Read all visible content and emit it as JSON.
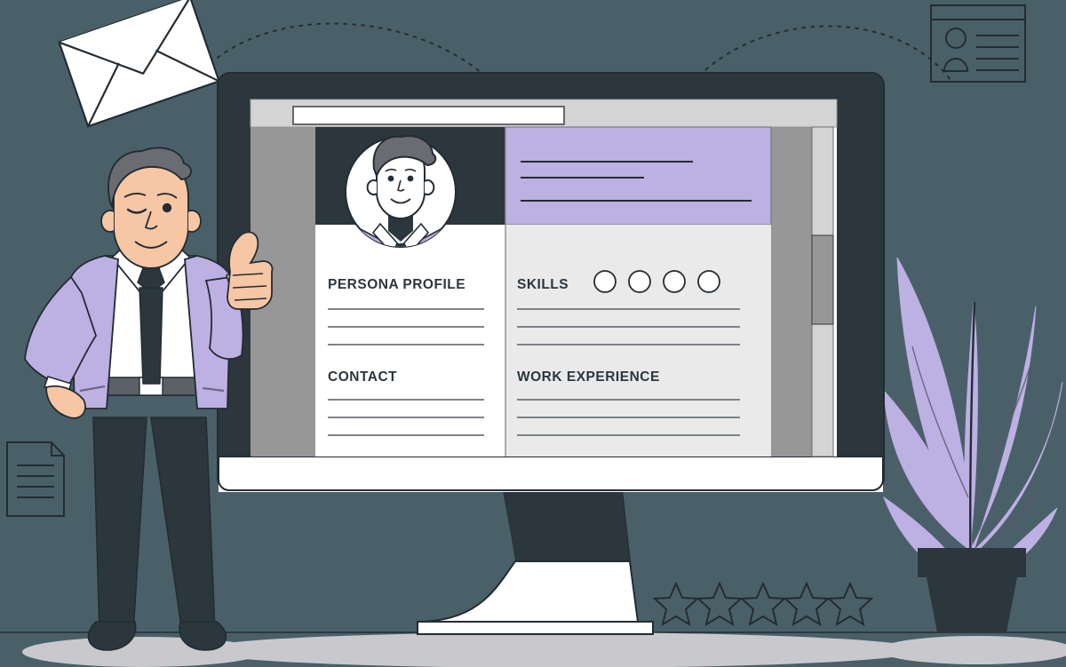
{
  "scene": {
    "title": "Resume builder illustration",
    "background_color": "#4a6069",
    "floor_color": "#c9c9cd",
    "ink_color": "#232c33",
    "accent_purple": "#bdb0e3",
    "skin_color": "#f7c6a4",
    "hair_color": "#6b6b72"
  },
  "monitor": {
    "name": "desktop-monitor",
    "bezel_color": "#2b363d",
    "frame_color": "#ffffff",
    "power_button_color": "#2b363d"
  },
  "browser": {
    "toolbar_color": "#d4d4d4",
    "url_bar": {
      "value": "",
      "placeholder": ""
    },
    "sidebar_color": "#979797",
    "scrollbar": {
      "track_color": "#d4d4d4",
      "thumb_color": "#979797"
    }
  },
  "resume": {
    "header": {
      "avatar": {
        "name": "profile-avatar",
        "background": "#2b363d"
      },
      "banner": {
        "background": "#bdb0e3",
        "lines": 3
      }
    },
    "left_column": {
      "background": "#ffffff",
      "sections": [
        {
          "heading": "PERSONA PROFILE",
          "lines": 3
        },
        {
          "heading": "CONTACT",
          "lines": 3
        }
      ]
    },
    "right_column": {
      "background": "#eaeaea",
      "sections": [
        {
          "heading": "SKILLS",
          "lines": 3,
          "rating_dots": 4
        },
        {
          "heading": "WORK EXPERIENCE",
          "lines": 3
        }
      ]
    }
  },
  "decor": {
    "envelope": {
      "name": "envelope",
      "fill": "#ffffff"
    },
    "id_card": {
      "name": "id-card",
      "lines": 4
    },
    "document": {
      "name": "document-page",
      "lines": 4
    },
    "stars": {
      "name": "rating-stars",
      "count": 5,
      "filled": 0
    },
    "plant": {
      "name": "potted-plant",
      "leaf_color": "#bdb0e3",
      "pot_color": "#2b363d",
      "leaves": 7
    },
    "dashed_arcs": 2
  },
  "character": {
    "name": "businessman-thumbs-up",
    "blazer_color": "#bdb0e3",
    "shirt_color": "#ffffff",
    "tie_color": "#2b363d",
    "trousers_color": "#2b363d",
    "gesture": "thumbs-up",
    "expression": "winking"
  }
}
